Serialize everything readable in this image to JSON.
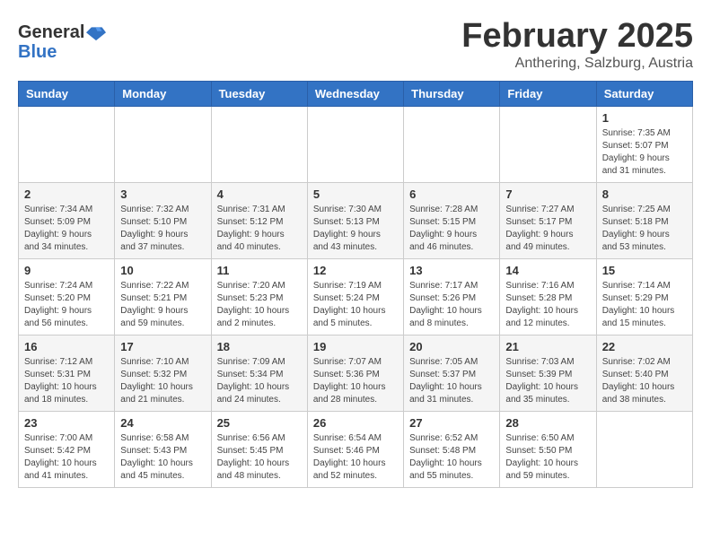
{
  "header": {
    "logo": {
      "line1": "General",
      "line2": "Blue"
    },
    "title": "February 2025",
    "subtitle": "Anthering, Salzburg, Austria"
  },
  "weekdays": [
    "Sunday",
    "Monday",
    "Tuesday",
    "Wednesday",
    "Thursday",
    "Friday",
    "Saturday"
  ],
  "weeks": [
    [
      {
        "day": "",
        "info": ""
      },
      {
        "day": "",
        "info": ""
      },
      {
        "day": "",
        "info": ""
      },
      {
        "day": "",
        "info": ""
      },
      {
        "day": "",
        "info": ""
      },
      {
        "day": "",
        "info": ""
      },
      {
        "day": "1",
        "info": "Sunrise: 7:35 AM\nSunset: 5:07 PM\nDaylight: 9 hours and 31 minutes."
      }
    ],
    [
      {
        "day": "2",
        "info": "Sunrise: 7:34 AM\nSunset: 5:09 PM\nDaylight: 9 hours and 34 minutes."
      },
      {
        "day": "3",
        "info": "Sunrise: 7:32 AM\nSunset: 5:10 PM\nDaylight: 9 hours and 37 minutes."
      },
      {
        "day": "4",
        "info": "Sunrise: 7:31 AM\nSunset: 5:12 PM\nDaylight: 9 hours and 40 minutes."
      },
      {
        "day": "5",
        "info": "Sunrise: 7:30 AM\nSunset: 5:13 PM\nDaylight: 9 hours and 43 minutes."
      },
      {
        "day": "6",
        "info": "Sunrise: 7:28 AM\nSunset: 5:15 PM\nDaylight: 9 hours and 46 minutes."
      },
      {
        "day": "7",
        "info": "Sunrise: 7:27 AM\nSunset: 5:17 PM\nDaylight: 9 hours and 49 minutes."
      },
      {
        "day": "8",
        "info": "Sunrise: 7:25 AM\nSunset: 5:18 PM\nDaylight: 9 hours and 53 minutes."
      }
    ],
    [
      {
        "day": "9",
        "info": "Sunrise: 7:24 AM\nSunset: 5:20 PM\nDaylight: 9 hours and 56 minutes."
      },
      {
        "day": "10",
        "info": "Sunrise: 7:22 AM\nSunset: 5:21 PM\nDaylight: 9 hours and 59 minutes."
      },
      {
        "day": "11",
        "info": "Sunrise: 7:20 AM\nSunset: 5:23 PM\nDaylight: 10 hours and 2 minutes."
      },
      {
        "day": "12",
        "info": "Sunrise: 7:19 AM\nSunset: 5:24 PM\nDaylight: 10 hours and 5 minutes."
      },
      {
        "day": "13",
        "info": "Sunrise: 7:17 AM\nSunset: 5:26 PM\nDaylight: 10 hours and 8 minutes."
      },
      {
        "day": "14",
        "info": "Sunrise: 7:16 AM\nSunset: 5:28 PM\nDaylight: 10 hours and 12 minutes."
      },
      {
        "day": "15",
        "info": "Sunrise: 7:14 AM\nSunset: 5:29 PM\nDaylight: 10 hours and 15 minutes."
      }
    ],
    [
      {
        "day": "16",
        "info": "Sunrise: 7:12 AM\nSunset: 5:31 PM\nDaylight: 10 hours and 18 minutes."
      },
      {
        "day": "17",
        "info": "Sunrise: 7:10 AM\nSunset: 5:32 PM\nDaylight: 10 hours and 21 minutes."
      },
      {
        "day": "18",
        "info": "Sunrise: 7:09 AM\nSunset: 5:34 PM\nDaylight: 10 hours and 24 minutes."
      },
      {
        "day": "19",
        "info": "Sunrise: 7:07 AM\nSunset: 5:36 PM\nDaylight: 10 hours and 28 minutes."
      },
      {
        "day": "20",
        "info": "Sunrise: 7:05 AM\nSunset: 5:37 PM\nDaylight: 10 hours and 31 minutes."
      },
      {
        "day": "21",
        "info": "Sunrise: 7:03 AM\nSunset: 5:39 PM\nDaylight: 10 hours and 35 minutes."
      },
      {
        "day": "22",
        "info": "Sunrise: 7:02 AM\nSunset: 5:40 PM\nDaylight: 10 hours and 38 minutes."
      }
    ],
    [
      {
        "day": "23",
        "info": "Sunrise: 7:00 AM\nSunset: 5:42 PM\nDaylight: 10 hours and 41 minutes."
      },
      {
        "day": "24",
        "info": "Sunrise: 6:58 AM\nSunset: 5:43 PM\nDaylight: 10 hours and 45 minutes."
      },
      {
        "day": "25",
        "info": "Sunrise: 6:56 AM\nSunset: 5:45 PM\nDaylight: 10 hours and 48 minutes."
      },
      {
        "day": "26",
        "info": "Sunrise: 6:54 AM\nSunset: 5:46 PM\nDaylight: 10 hours and 52 minutes."
      },
      {
        "day": "27",
        "info": "Sunrise: 6:52 AM\nSunset: 5:48 PM\nDaylight: 10 hours and 55 minutes."
      },
      {
        "day": "28",
        "info": "Sunrise: 6:50 AM\nSunset: 5:50 PM\nDaylight: 10 hours and 59 minutes."
      },
      {
        "day": "",
        "info": ""
      }
    ]
  ]
}
